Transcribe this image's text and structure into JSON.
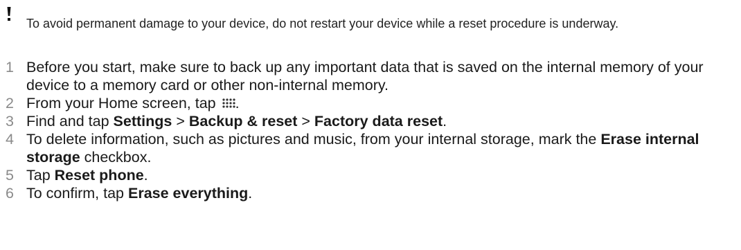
{
  "note": {
    "icon": "exclamation-icon",
    "text": "To avoid permanent damage to your device, do not restart your device while a reset procedure is underway."
  },
  "steps": [
    {
      "number": "1",
      "parts": [
        "Before you start, make sure to back up any important data that is saved on the internal memory of your device to a memory card or other non-internal memory."
      ]
    },
    {
      "number": "2",
      "parts": [
        "From your Home screen, tap ",
        "."
      ],
      "icon": "application-screen-icon"
    },
    {
      "number": "3",
      "parts": [
        "Find and tap ",
        "Settings",
        " > ",
        "Backup & reset",
        " > ",
        "Factory data reset",
        "."
      ]
    },
    {
      "number": "4",
      "parts": [
        "To delete information, such as pictures and music, from your internal storage, mark the ",
        "Erase internal storage",
        " checkbox."
      ]
    },
    {
      "number": "5",
      "parts": [
        "Tap ",
        "Reset phone",
        "."
      ]
    },
    {
      "number": "6",
      "parts": [
        "To confirm, tap ",
        "Erase everything",
        "."
      ]
    }
  ]
}
